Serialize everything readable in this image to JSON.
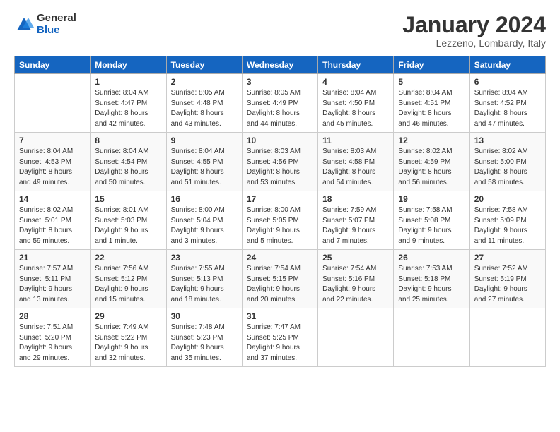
{
  "logo": {
    "general": "General",
    "blue": "Blue"
  },
  "title": "January 2024",
  "location": "Lezzeno, Lombardy, Italy",
  "headers": [
    "Sunday",
    "Monday",
    "Tuesday",
    "Wednesday",
    "Thursday",
    "Friday",
    "Saturday"
  ],
  "weeks": [
    [
      {
        "day": "",
        "info": ""
      },
      {
        "day": "1",
        "info": "Sunrise: 8:04 AM\nSunset: 4:47 PM\nDaylight: 8 hours\nand 42 minutes."
      },
      {
        "day": "2",
        "info": "Sunrise: 8:05 AM\nSunset: 4:48 PM\nDaylight: 8 hours\nand 43 minutes."
      },
      {
        "day": "3",
        "info": "Sunrise: 8:05 AM\nSunset: 4:49 PM\nDaylight: 8 hours\nand 44 minutes."
      },
      {
        "day": "4",
        "info": "Sunrise: 8:04 AM\nSunset: 4:50 PM\nDaylight: 8 hours\nand 45 minutes."
      },
      {
        "day": "5",
        "info": "Sunrise: 8:04 AM\nSunset: 4:51 PM\nDaylight: 8 hours\nand 46 minutes."
      },
      {
        "day": "6",
        "info": "Sunrise: 8:04 AM\nSunset: 4:52 PM\nDaylight: 8 hours\nand 47 minutes."
      }
    ],
    [
      {
        "day": "7",
        "info": "Sunrise: 8:04 AM\nSunset: 4:53 PM\nDaylight: 8 hours\nand 49 minutes."
      },
      {
        "day": "8",
        "info": "Sunrise: 8:04 AM\nSunset: 4:54 PM\nDaylight: 8 hours\nand 50 minutes."
      },
      {
        "day": "9",
        "info": "Sunrise: 8:04 AM\nSunset: 4:55 PM\nDaylight: 8 hours\nand 51 minutes."
      },
      {
        "day": "10",
        "info": "Sunrise: 8:03 AM\nSunset: 4:56 PM\nDaylight: 8 hours\nand 53 minutes."
      },
      {
        "day": "11",
        "info": "Sunrise: 8:03 AM\nSunset: 4:58 PM\nDaylight: 8 hours\nand 54 minutes."
      },
      {
        "day": "12",
        "info": "Sunrise: 8:02 AM\nSunset: 4:59 PM\nDaylight: 8 hours\nand 56 minutes."
      },
      {
        "day": "13",
        "info": "Sunrise: 8:02 AM\nSunset: 5:00 PM\nDaylight: 8 hours\nand 58 minutes."
      }
    ],
    [
      {
        "day": "14",
        "info": "Sunrise: 8:02 AM\nSunset: 5:01 PM\nDaylight: 8 hours\nand 59 minutes."
      },
      {
        "day": "15",
        "info": "Sunrise: 8:01 AM\nSunset: 5:03 PM\nDaylight: 9 hours\nand 1 minute."
      },
      {
        "day": "16",
        "info": "Sunrise: 8:00 AM\nSunset: 5:04 PM\nDaylight: 9 hours\nand 3 minutes."
      },
      {
        "day": "17",
        "info": "Sunrise: 8:00 AM\nSunset: 5:05 PM\nDaylight: 9 hours\nand 5 minutes."
      },
      {
        "day": "18",
        "info": "Sunrise: 7:59 AM\nSunset: 5:07 PM\nDaylight: 9 hours\nand 7 minutes."
      },
      {
        "day": "19",
        "info": "Sunrise: 7:58 AM\nSunset: 5:08 PM\nDaylight: 9 hours\nand 9 minutes."
      },
      {
        "day": "20",
        "info": "Sunrise: 7:58 AM\nSunset: 5:09 PM\nDaylight: 9 hours\nand 11 minutes."
      }
    ],
    [
      {
        "day": "21",
        "info": "Sunrise: 7:57 AM\nSunset: 5:11 PM\nDaylight: 9 hours\nand 13 minutes."
      },
      {
        "day": "22",
        "info": "Sunrise: 7:56 AM\nSunset: 5:12 PM\nDaylight: 9 hours\nand 15 minutes."
      },
      {
        "day": "23",
        "info": "Sunrise: 7:55 AM\nSunset: 5:13 PM\nDaylight: 9 hours\nand 18 minutes."
      },
      {
        "day": "24",
        "info": "Sunrise: 7:54 AM\nSunset: 5:15 PM\nDaylight: 9 hours\nand 20 minutes."
      },
      {
        "day": "25",
        "info": "Sunrise: 7:54 AM\nSunset: 5:16 PM\nDaylight: 9 hours\nand 22 minutes."
      },
      {
        "day": "26",
        "info": "Sunrise: 7:53 AM\nSunset: 5:18 PM\nDaylight: 9 hours\nand 25 minutes."
      },
      {
        "day": "27",
        "info": "Sunrise: 7:52 AM\nSunset: 5:19 PM\nDaylight: 9 hours\nand 27 minutes."
      }
    ],
    [
      {
        "day": "28",
        "info": "Sunrise: 7:51 AM\nSunset: 5:20 PM\nDaylight: 9 hours\nand 29 minutes."
      },
      {
        "day": "29",
        "info": "Sunrise: 7:49 AM\nSunset: 5:22 PM\nDaylight: 9 hours\nand 32 minutes."
      },
      {
        "day": "30",
        "info": "Sunrise: 7:48 AM\nSunset: 5:23 PM\nDaylight: 9 hours\nand 35 minutes."
      },
      {
        "day": "31",
        "info": "Sunrise: 7:47 AM\nSunset: 5:25 PM\nDaylight: 9 hours\nand 37 minutes."
      },
      {
        "day": "",
        "info": ""
      },
      {
        "day": "",
        "info": ""
      },
      {
        "day": "",
        "info": ""
      }
    ]
  ]
}
